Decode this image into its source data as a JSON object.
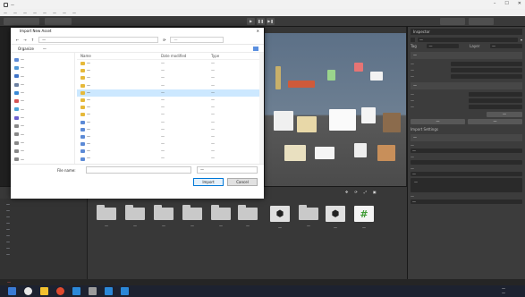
{
  "app": {
    "title": "—"
  },
  "menu": [
    "—",
    "—",
    "—",
    "—",
    "—",
    "—",
    "—",
    "—"
  ],
  "toolbar": {
    "play_icon": "play-icon",
    "pause_icon": "pause-icon",
    "step_icon": "step-icon"
  },
  "dialog": {
    "title": "Import New Asset",
    "path": "—",
    "search_placeholder": "—",
    "organize": "Organize",
    "new_folder": "—",
    "columns": {
      "name": "Name",
      "date": "Date modified",
      "type": "Type"
    },
    "tree": [
      "—",
      "—",
      "—",
      "—",
      "—",
      "—",
      "—",
      "—",
      "—",
      "—",
      "—",
      "—",
      "—"
    ],
    "files": [
      {
        "name": "—",
        "date": "—",
        "type": "—",
        "kind": "folder"
      },
      {
        "name": "—",
        "date": "—",
        "type": "—",
        "kind": "folder"
      },
      {
        "name": "—",
        "date": "—",
        "type": "—",
        "kind": "folder"
      },
      {
        "name": "—",
        "date": "—",
        "type": "—",
        "kind": "folder"
      },
      {
        "name": "—",
        "date": "—",
        "type": "—",
        "kind": "folder",
        "selected": true
      },
      {
        "name": "—",
        "date": "—",
        "type": "—",
        "kind": "folder"
      },
      {
        "name": "—",
        "date": "—",
        "type": "—",
        "kind": "folder"
      },
      {
        "name": "—",
        "date": "—",
        "type": "—",
        "kind": "folder"
      },
      {
        "name": "—",
        "date": "—",
        "type": "—",
        "kind": "prefab"
      },
      {
        "name": "—",
        "date": "—",
        "type": "—",
        "kind": "prefab"
      },
      {
        "name": "—",
        "date": "—",
        "type": "—",
        "kind": "prefab"
      },
      {
        "name": "—",
        "date": "—",
        "type": "—",
        "kind": "prefab"
      },
      {
        "name": "—",
        "date": "—",
        "type": "—",
        "kind": "prefab"
      },
      {
        "name": "—",
        "date": "—",
        "type": "—",
        "kind": "prefab"
      }
    ],
    "file_name_label": "File name:",
    "filter": "—",
    "import_label": "Import",
    "cancel_label": "Cancel"
  },
  "inspector": {
    "tab": "Inspector",
    "object_name": "—",
    "tag": "—",
    "layer": "—",
    "transform": "—",
    "transform_rows": [
      "—",
      "—",
      "—"
    ],
    "component": "—",
    "component_rows": [
      "—",
      "—",
      "—"
    ],
    "add_target": "—",
    "buttons": [
      "—",
      "—"
    ],
    "import_settings": "Import Settings",
    "settings_header": "—",
    "field1": "—",
    "field1_value": "—",
    "field2": "—",
    "field3": "—",
    "field3_value": "—",
    "list_empty": "—",
    "field4": "—",
    "field4_value": "—"
  },
  "project": {
    "tree": [
      "—",
      "—",
      "—",
      "—",
      "—",
      "—",
      "—",
      "—",
      "—"
    ],
    "folders": [
      "—",
      "—",
      "—",
      "—",
      "—",
      "—",
      "—"
    ],
    "assets": [
      {
        "label": "—",
        "icon": "unity-prefab-icon",
        "color": "#e0e0e0"
      },
      {
        "label": "—",
        "icon": "image-asset-icon",
        "color": "#a8d47a"
      },
      {
        "label": "—",
        "icon": "unity-prefab-icon",
        "color": "#e0e0e0"
      },
      {
        "label": "—",
        "icon": "hash-script-icon",
        "color": "#5fb04a"
      }
    ]
  },
  "status": {
    "message": "—"
  },
  "clock": {
    "time": "—",
    "date": "—"
  },
  "taskbar_colors": [
    "#3a7bd5",
    "#e7e7e7",
    "#f2c12e",
    "#e04a2e",
    "#2b88d8",
    "#9c9c9c",
    "#2b88d8",
    "#2b88d8"
  ]
}
